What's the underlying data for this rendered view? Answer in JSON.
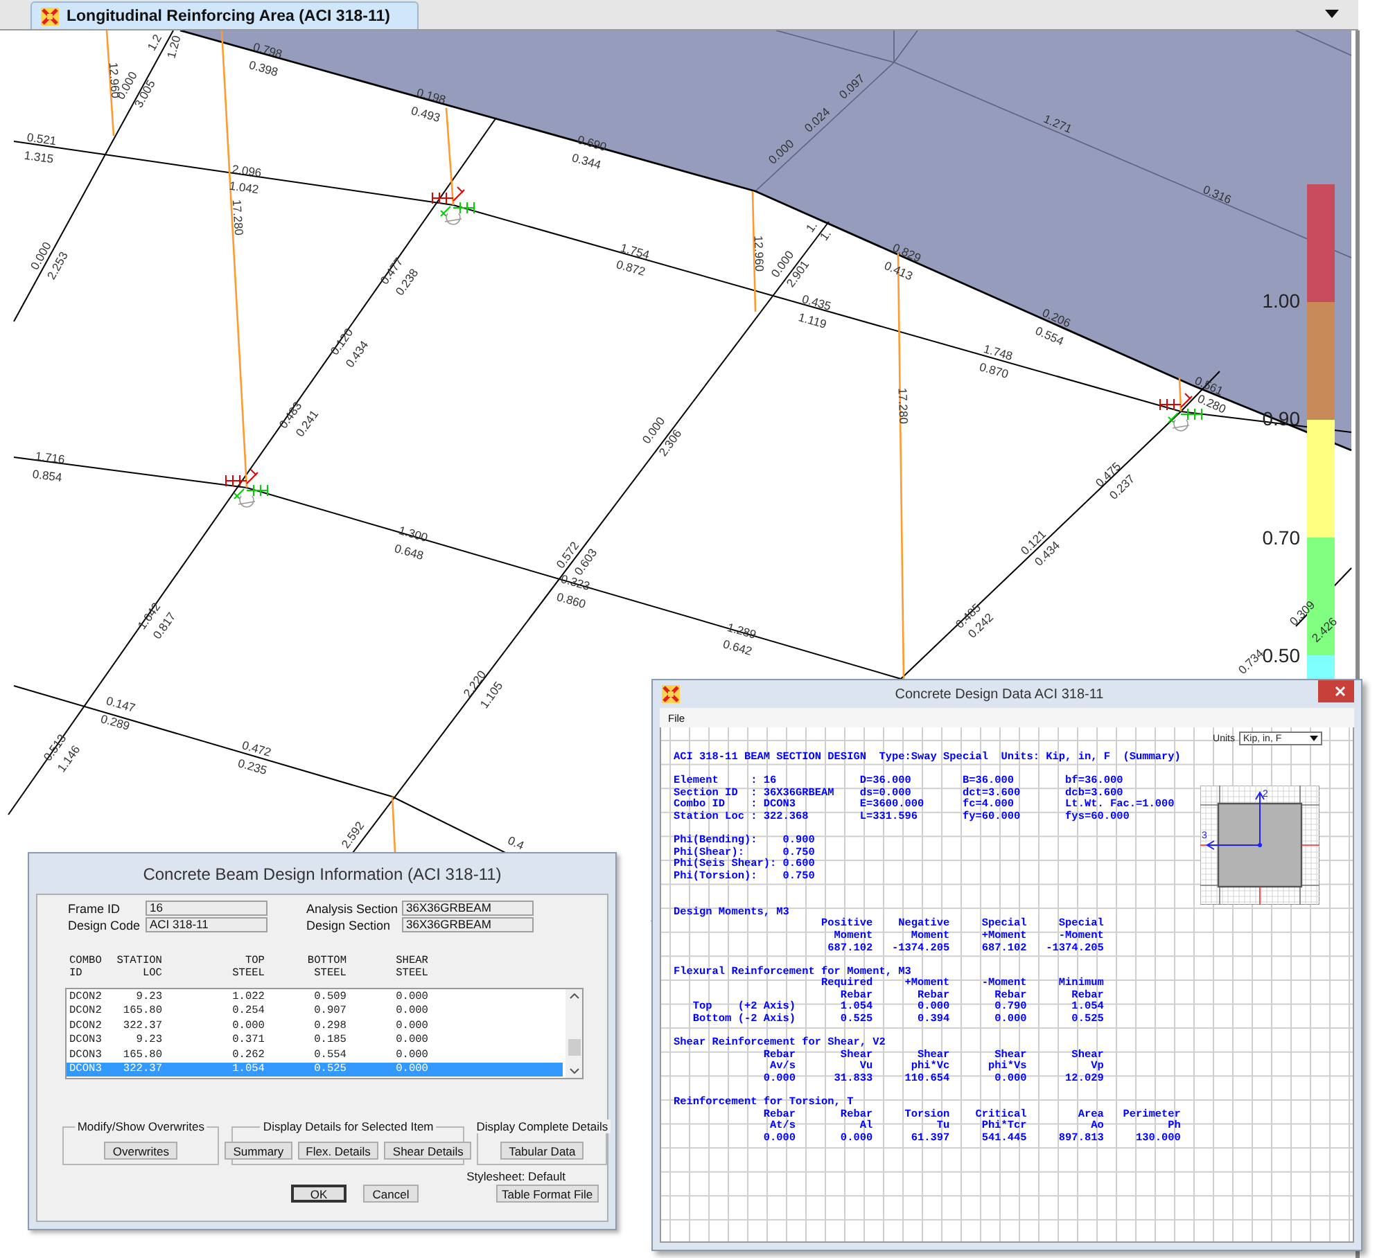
{
  "view": {
    "tab_title": "Longitudinal Reinforcing Area  (ACI 318-11)"
  },
  "diagram": {
    "member_labels": [
      "12.960",
      "0.000",
      "3.005",
      "1.2",
      "1.20",
      "0.798",
      "0.398",
      "0.198",
      "0.493",
      "0.690",
      "0.344",
      "0.521",
      "1.315",
      "2.096",
      "1.042",
      "17.280",
      "0.000",
      "2.253",
      "0.477",
      "0.238",
      "0.120",
      "0.434",
      "1.754",
      "0.872",
      "0.000",
      "0.024",
      "0.097",
      "1.271",
      "0.316",
      "12.960",
      "1.",
      "1.",
      "0.000",
      "2.901",
      "0.829",
      "0.413",
      "0.435",
      "1.119",
      "0.206",
      "0.554",
      "1.748",
      "0.870",
      "17.280",
      "0.561",
      "0.280",
      "0.475",
      "0.237",
      "0.121",
      "0.434",
      "0.485",
      "0.242",
      "1.289",
      "0.642",
      "0.309",
      "2.426",
      "0.734",
      "1.716",
      "0.854",
      "0.483",
      "0.241",
      "0.000",
      "2.306",
      "1.300",
      "0.648",
      "0.572",
      "0.603",
      "0.323",
      "0.860",
      "1.642",
      "0.817",
      "0.147",
      "0.289",
      "0.513",
      "1.146",
      "0.472",
      "0.235",
      "2.220",
      "1.105",
      "2.592",
      "0.4"
    ],
    "legend": {
      "bands": [
        {
          "color": "#c84c5c"
        },
        {
          "color": "#c98a5a"
        },
        {
          "color": "#ffff80"
        },
        {
          "color": "#80ff80"
        },
        {
          "color": "#80ffff"
        }
      ],
      "ticks": [
        "1.00",
        "0.90",
        "0.70",
        "0.50"
      ]
    }
  },
  "beam_dialog": {
    "title": "Concrete Beam Design Information (ACI 318-11)",
    "fields": [
      {
        "label": "Frame ID",
        "value": "16"
      },
      {
        "label": "Analysis Section",
        "value": "36X36GRBEAM"
      },
      {
        "label": "Design Code",
        "value": "ACI 318-11"
      },
      {
        "label": "Design Section",
        "value": "36X36GRBEAM"
      }
    ],
    "table": {
      "header_lines": [
        [
          "COMBO",
          "STATION",
          "TOP",
          "BOTTOM",
          "SHEAR"
        ],
        [
          "ID",
          "LOC",
          "STEEL",
          "STEEL",
          "STEEL"
        ]
      ],
      "rows": [
        {
          "cells": [
            "DCON2",
            "9.23",
            "1.022",
            "0.509",
            "0.000"
          ],
          "selected": false
        },
        {
          "cells": [
            "DCON2",
            "165.80",
            "0.254",
            "0.907",
            "0.000"
          ],
          "selected": false
        },
        {
          "cells": [
            "DCON2",
            "322.37",
            "0.000",
            "0.298",
            "0.000"
          ],
          "selected": false
        },
        {
          "cells": [
            "DCON3",
            "9.23",
            "0.371",
            "0.185",
            "0.000"
          ],
          "selected": false
        },
        {
          "cells": [
            "DCON3",
            "165.80",
            "0.262",
            "0.554",
            "0.000"
          ],
          "selected": false
        },
        {
          "cells": [
            "DCON3",
            "322.37",
            "1.054",
            "0.525",
            "0.000"
          ],
          "selected": true
        }
      ]
    },
    "groups": [
      {
        "title": "Modify/Show Overwrites",
        "buttons": [
          "Overwrites"
        ]
      },
      {
        "title": "Display Details for Selected Item",
        "buttons": [
          "Summary",
          "Flex. Details",
          "Shear Details"
        ]
      },
      {
        "title": "Display Complete Details",
        "buttons": [
          "Tabular Data"
        ]
      }
    ],
    "stylesheet": "Stylesheet: Default",
    "buttons": [
      {
        "label": "OK",
        "default": true
      },
      {
        "label": "Cancel",
        "default": false
      },
      {
        "label": "Table Format File",
        "default": false
      }
    ]
  },
  "design_dialog": {
    "title": "Concrete Design Data  ACI 318-11",
    "menu": [
      "File"
    ],
    "units_label": "Units",
    "units_value": "Kip, in, F",
    "report_blocks": [
      [
        "ACI 318-11 BEAM SECTION DESIGN  Type:Sway Special  Units: Kip, in, F  (Summary)"
      ],
      [
        "Element     : 16             D=36.000        B=36.000        bf=36.000",
        "Section ID  : 36X36GRBEAM    ds=0.000        dct=3.600       dcb=3.600",
        "Combo ID    : DCON3          E=3600.000      fc=4.000        Lt.Wt. Fac.=1.000",
        "Station Loc : 322.368        L=331.596       fy=60.000       fys=60.000"
      ],
      [
        "Phi(Bending):    0.900",
        "Phi(Shear):      0.750",
        "Phi(Seis Shear): 0.600",
        "Phi(Torsion):    0.750"
      ],
      [
        "Design Moments, M3",
        "                       Positive    Negative     Special     Special",
        "                         Moment      Moment     +Moment     -Moment",
        "                        687.102   -1374.205     687.102   -1374.205"
      ],
      [
        "Flexural Reinforcement for Moment, M3",
        "                       Required     +Moment     -Moment     Minimum",
        "                          Rebar       Rebar       Rebar       Rebar",
        "   Top    (+2 Axis)       1.054       0.000       0.790       1.054",
        "   Bottom (-2 Axis)       0.525       0.394       0.000       0.525"
      ],
      [
        "Shear Reinforcement for Shear, V2",
        "              Rebar       Shear       Shear       Shear       Shear",
        "               Av/s          Vu      phi*Vc      phi*Vs          Vp",
        "              0.000      31.833     110.654       0.000      12.029"
      ],
      [
        "Reinforcement for Torsion, T",
        "              Rebar       Rebar     Torsion    Critical        Area   Perimeter",
        "               At/s          Al          Tu     Phi*Tcr          Ao          Ph",
        "              0.000       0.000      61.397     541.445     897.813     130.000"
      ]
    ],
    "section_axes": [
      "2",
      "3"
    ]
  }
}
